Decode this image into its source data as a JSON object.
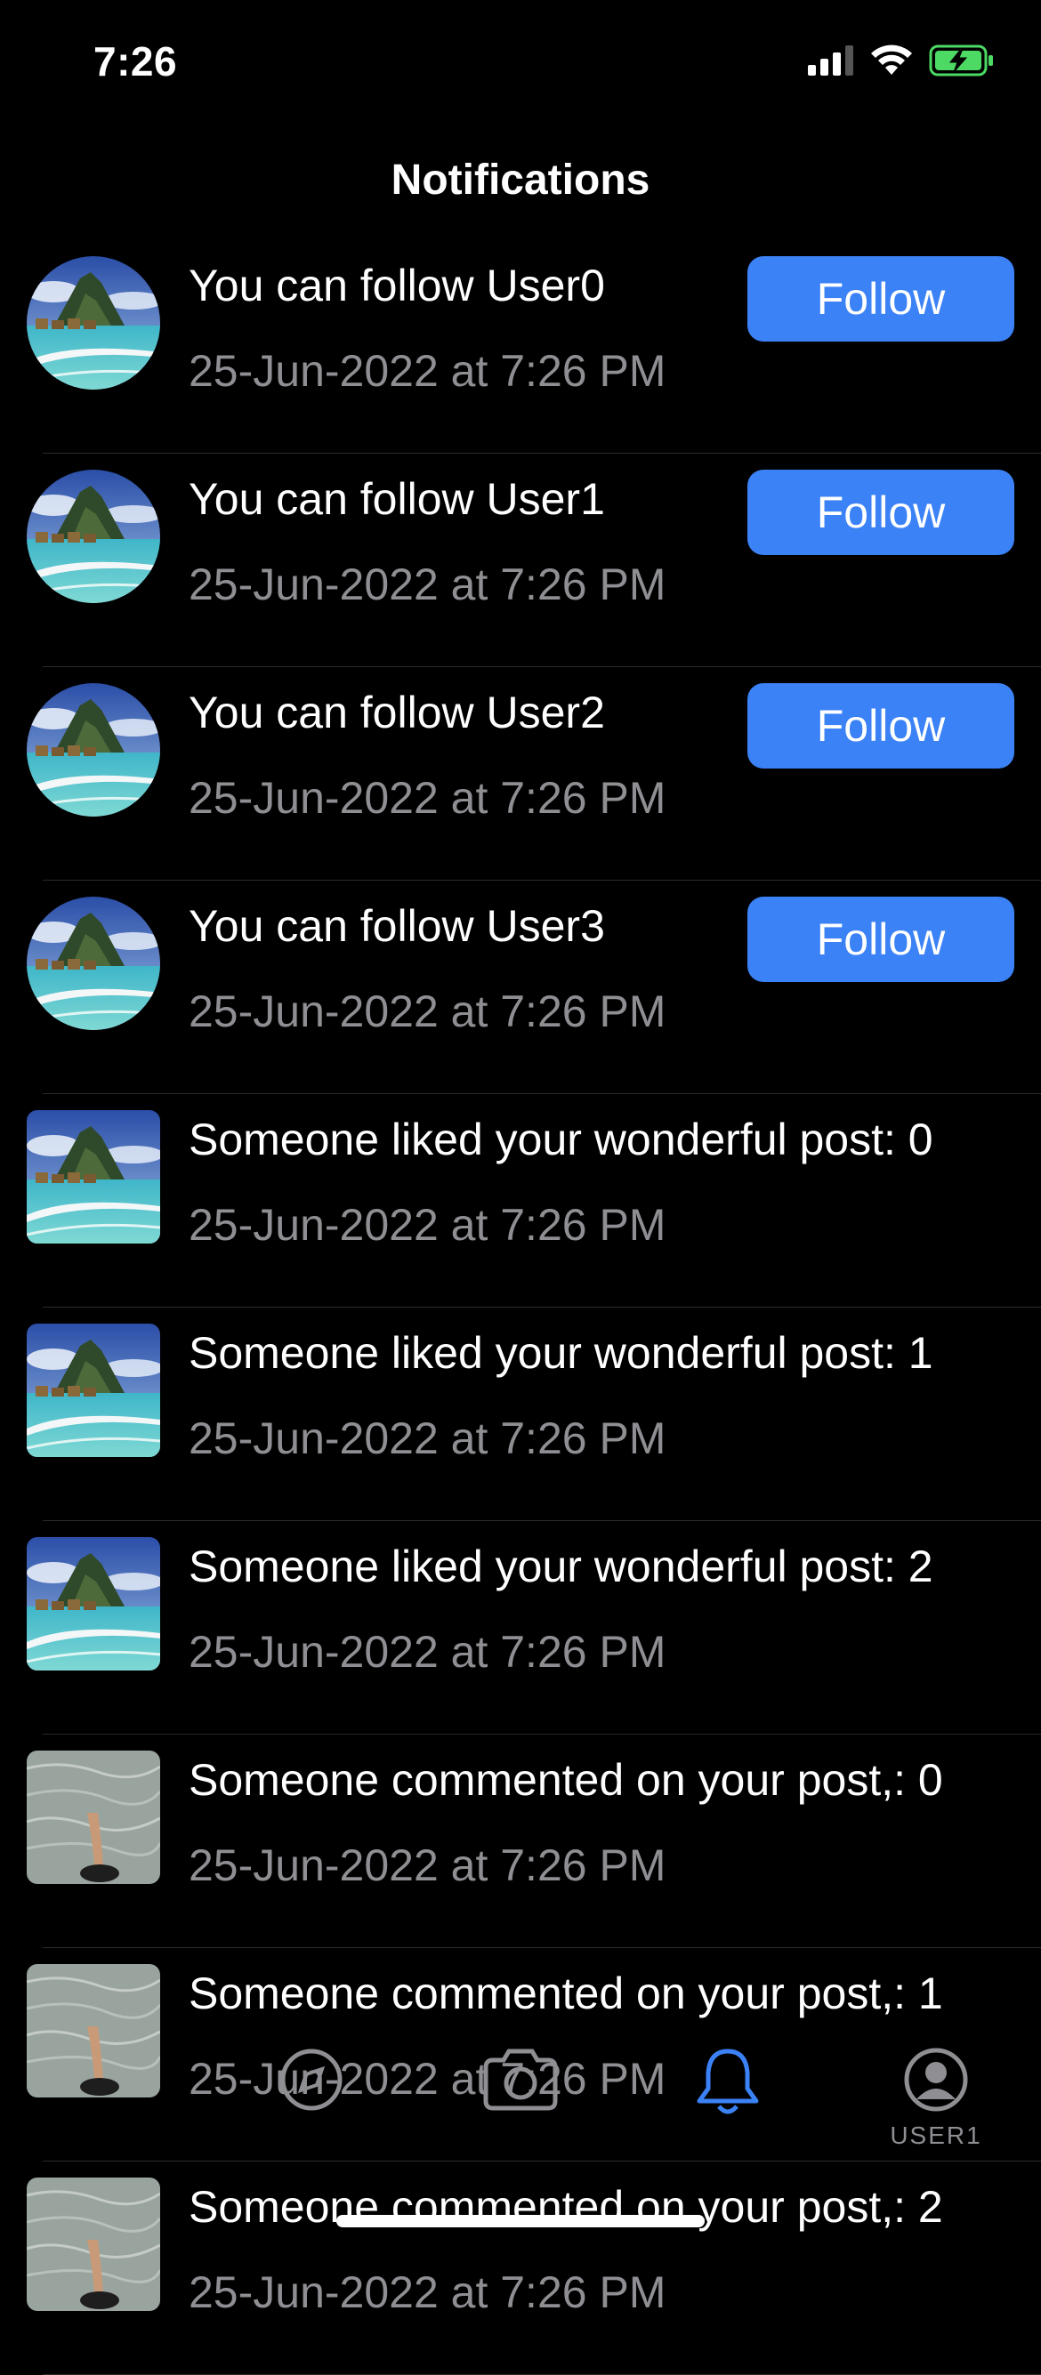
{
  "status_bar": {
    "time": "7:26"
  },
  "nav": {
    "title": "Notifications"
  },
  "notifications": [
    {
      "type": "follow",
      "title": "You can follow User0",
      "date": "25-Jun-2022 at 7:26 PM",
      "button": "Follow",
      "thumb": "island"
    },
    {
      "type": "follow",
      "title": "You can follow User1",
      "date": "25-Jun-2022 at 7:26 PM",
      "button": "Follow",
      "thumb": "island"
    },
    {
      "type": "follow",
      "title": "You can follow User2",
      "date": "25-Jun-2022 at 7:26 PM",
      "button": "Follow",
      "thumb": "island"
    },
    {
      "type": "follow",
      "title": "You can follow User3",
      "date": "25-Jun-2022 at 7:26 PM",
      "button": "Follow",
      "thumb": "island"
    },
    {
      "type": "like",
      "title": " Someone liked your wonderful post: 0",
      "date": "25-Jun-2022 at 7:26 PM",
      "thumb": "island"
    },
    {
      "type": "like",
      "title": " Someone liked your wonderful post: 1",
      "date": "25-Jun-2022 at 7:26 PM",
      "thumb": "island"
    },
    {
      "type": "like",
      "title": " Someone liked your wonderful post: 2",
      "date": "25-Jun-2022 at 7:26 PM",
      "thumb": "island"
    },
    {
      "type": "comment",
      "title": "Someone commented on your post,: 0",
      "date": "25-Jun-2022 at 7:26 PM",
      "thumb": "water"
    },
    {
      "type": "comment",
      "title": "Someone commented on your post,: 1",
      "date": "25-Jun-2022 at 7:26 PM",
      "thumb": "water"
    },
    {
      "type": "comment",
      "title": "Someone commented on your post,: 2",
      "date": "25-Jun-2022 at 7:26 PM",
      "thumb": "water"
    }
  ],
  "tab_bar": {
    "items": [
      {
        "icon": "explore-icon",
        "label": ""
      },
      {
        "icon": "camera-icon",
        "label": ""
      },
      {
        "icon": "bell-icon",
        "label": "",
        "active": true
      },
      {
        "icon": "profile-icon",
        "label": "USER1"
      }
    ],
    "active_color": "#3b82f6",
    "inactive_color": "#8e8e93"
  },
  "colors": {
    "accent": "#3b82f6",
    "background": "#000000",
    "secondary_text": "#8e8e93"
  }
}
